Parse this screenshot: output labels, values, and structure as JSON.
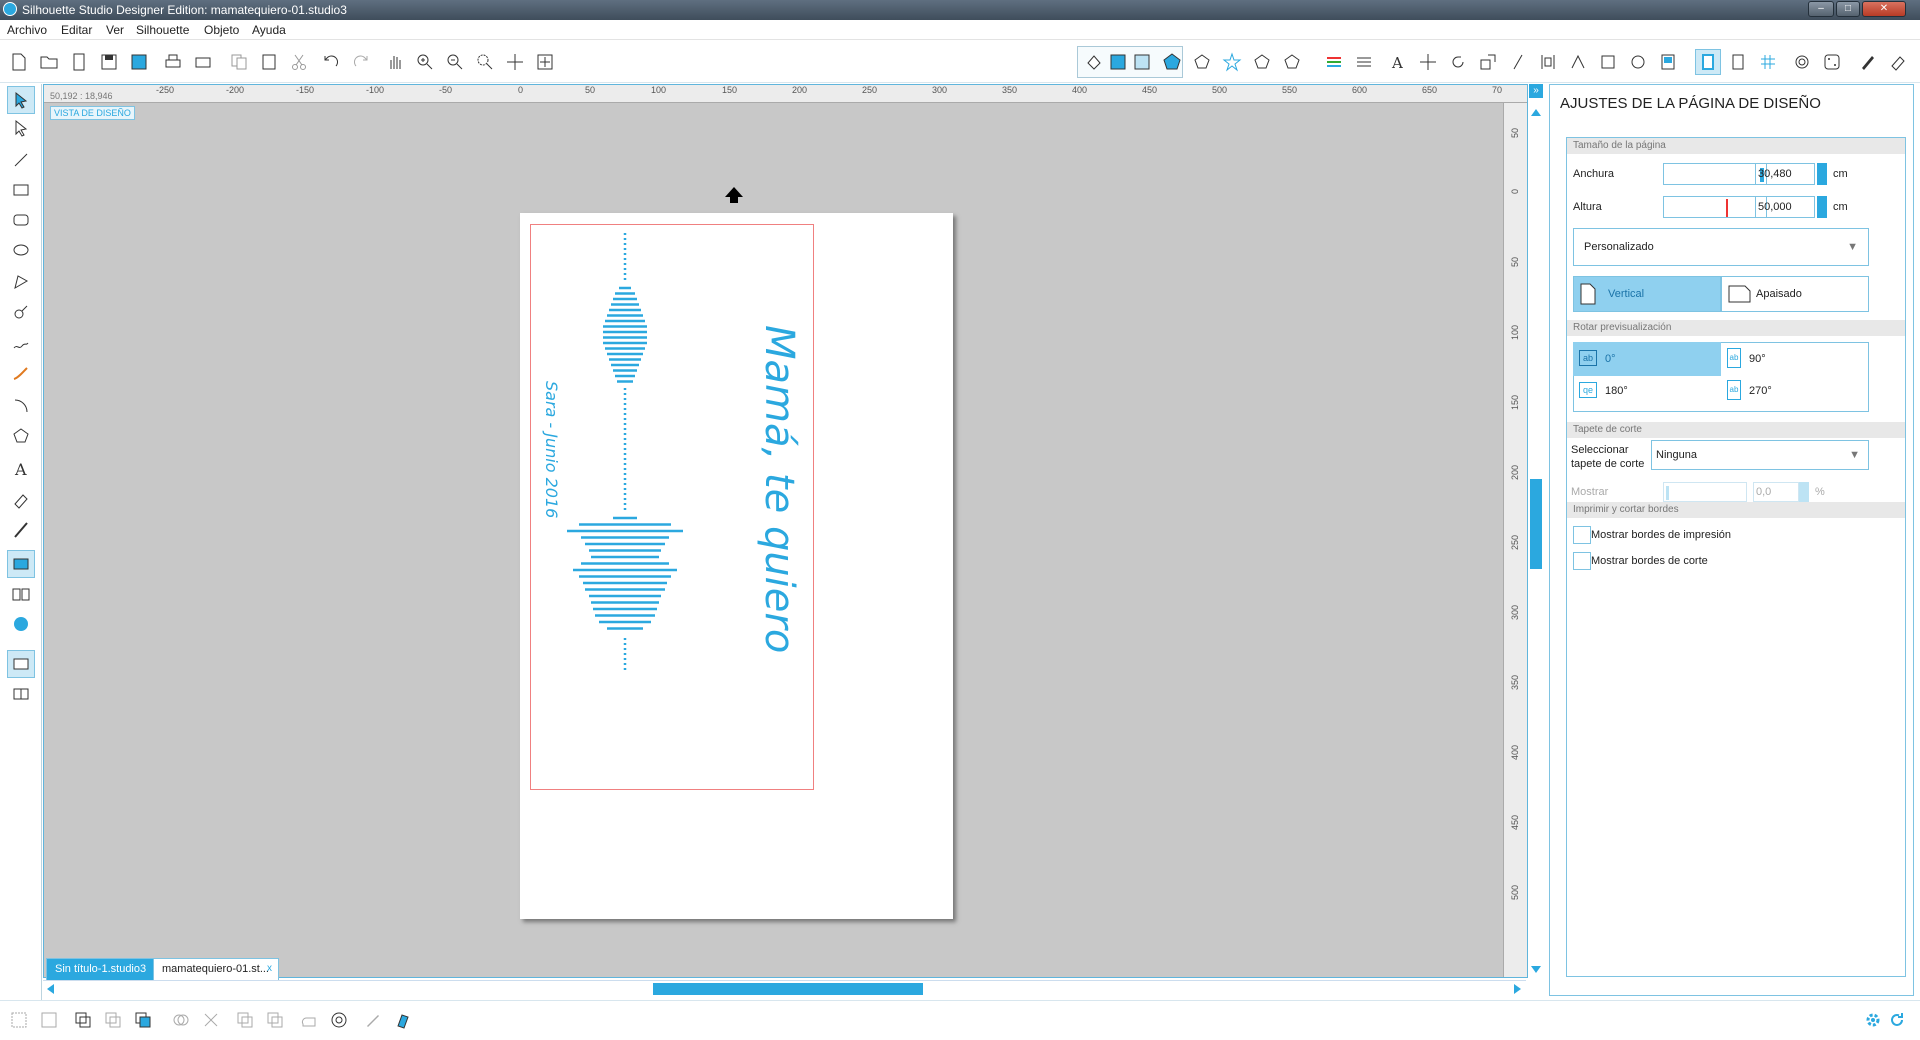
{
  "window": {
    "title": "Silhouette Studio Designer Edition: mamatequiero-01.studio3"
  },
  "menu": [
    "Archivo",
    "Editar",
    "Ver",
    "Silhouette",
    "Objeto",
    "Ayuda"
  ],
  "canvas": {
    "coords": "50,192 : 18,946",
    "view_label": "VISTA DE DISEÑO",
    "ruler_h": [
      "-250",
      "-200",
      "-150",
      "-100",
      "-50",
      "0",
      "50",
      "100",
      "150",
      "200",
      "250",
      "300",
      "350",
      "400",
      "450",
      "500",
      "550",
      "600",
      "650",
      "70"
    ],
    "ruler_v": [
      "50",
      "0",
      "50",
      "100",
      "150",
      "200",
      "250",
      "300",
      "350",
      "400",
      "450",
      "500"
    ],
    "design_text_main": "Mamá, te quiero",
    "design_text_sub": "Sara - Junio 2016",
    "accent": "#2ba8df"
  },
  "tabs": [
    {
      "label": "Sin título-1.studio3",
      "close": "x"
    },
    {
      "label": "mamatequiero-01.st...",
      "close": "x"
    }
  ],
  "panel": {
    "title": "AJUSTES DE LA PÁGINA DE DISEÑO",
    "size_section": "Tamaño de la página",
    "width_label": "Anchura",
    "width_value": "30,480",
    "height_label": "Altura",
    "height_value": "50,000",
    "unit": "cm",
    "preset": "Personalizado",
    "orient_vertical": "Vertical",
    "orient_landscape": "Apaisado",
    "rotate_section": "Rotar previsualización",
    "rot_0": "0°",
    "rot_90": "90°",
    "rot_180": "180°",
    "rot_270": "270°",
    "mat_section": "Tapete de corte",
    "mat_label_1": "Seleccionar",
    "mat_label_2": "tapete de corte",
    "mat_value": "Ninguna",
    "show_label": "Mostrar",
    "show_value": "0,0",
    "show_unit": "%",
    "print_section": "Imprimir y cortar bordes",
    "print_borders": "Mostrar bordes de impresión",
    "cut_borders": "Mostrar bordes de corte"
  }
}
